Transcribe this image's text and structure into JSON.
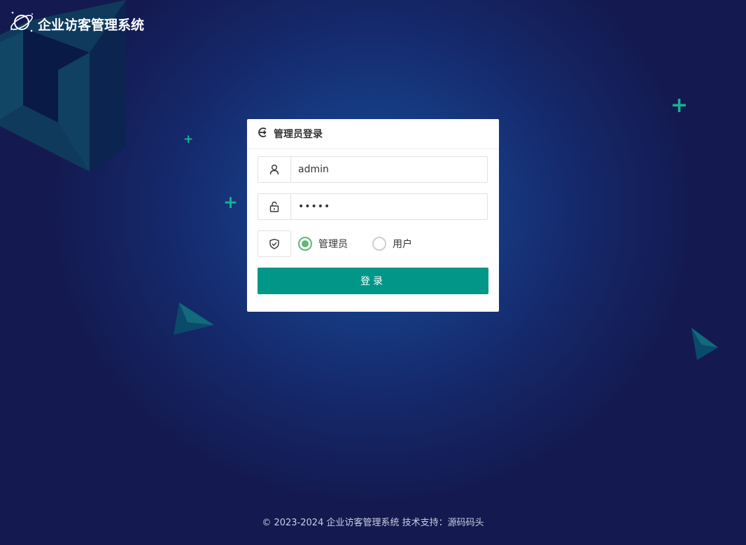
{
  "app": {
    "title": "企业访客管理系统"
  },
  "login_card": {
    "title": "管理员登录",
    "username_value": "admin",
    "password_value": "•••••",
    "roles": [
      {
        "label": "管理员",
        "checked": true
      },
      {
        "label": "用户",
        "checked": false
      }
    ],
    "submit_label": "登录"
  },
  "footer": {
    "text": "© 2023-2024 企业访客管理系统 技术支持：源码码头"
  },
  "colors": {
    "accent": "#009688",
    "radio_checked": "#5fb878",
    "decoration": "#13b495"
  },
  "icons": {
    "logo": "planet-icon",
    "card_header": "login-icon",
    "username": "user-icon",
    "password": "lock-icon",
    "role": "shield-icon"
  }
}
